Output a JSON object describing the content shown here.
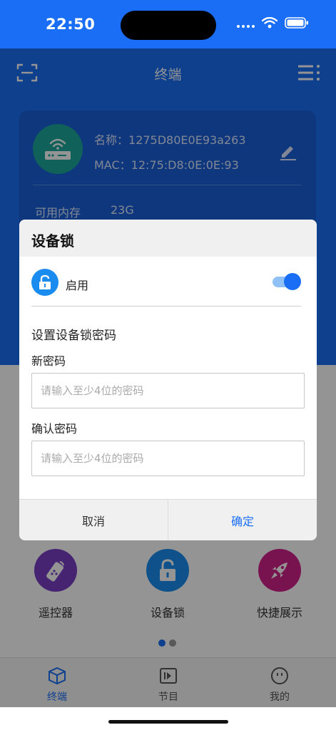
{
  "status": {
    "time": "22:50"
  },
  "header": {
    "title": "终端"
  },
  "device": {
    "name_label": "名称：",
    "name": "1275D80E0E93a263",
    "mac_label": "MAC：",
    "mac": "12:75:D8:0E:0E:93",
    "memory_label": "可用内存",
    "memory_value": "23G"
  },
  "quick_actions": [
    {
      "label": "遥控器",
      "icon": "remote-icon",
      "color": "#7b3fc4"
    },
    {
      "label": "设备锁",
      "icon": "lock-icon",
      "color": "#1a8cf0"
    },
    {
      "label": "快捷展示",
      "icon": "rocket-icon",
      "color": "#d0218a"
    }
  ],
  "tabs": [
    {
      "label": "终端",
      "icon": "cube-icon",
      "active": true
    },
    {
      "label": "节目",
      "icon": "play-icon",
      "active": false
    },
    {
      "label": "我的",
      "icon": "face-icon",
      "active": false
    }
  ],
  "dialog": {
    "title": "设备锁",
    "enable_label": "启用",
    "enabled": true,
    "section_title": "设置设备锁密码",
    "new_password_label": "新密码",
    "new_password_placeholder": "请输入至少4位的密码",
    "confirm_password_label": "确认密码",
    "confirm_password_placeholder": "请输入至少4位的密码",
    "cancel_label": "取消",
    "confirm_label": "确定"
  },
  "colors": {
    "primary": "#1a6ef5",
    "card": "#1a5fd8",
    "router": "#1aa89a"
  }
}
